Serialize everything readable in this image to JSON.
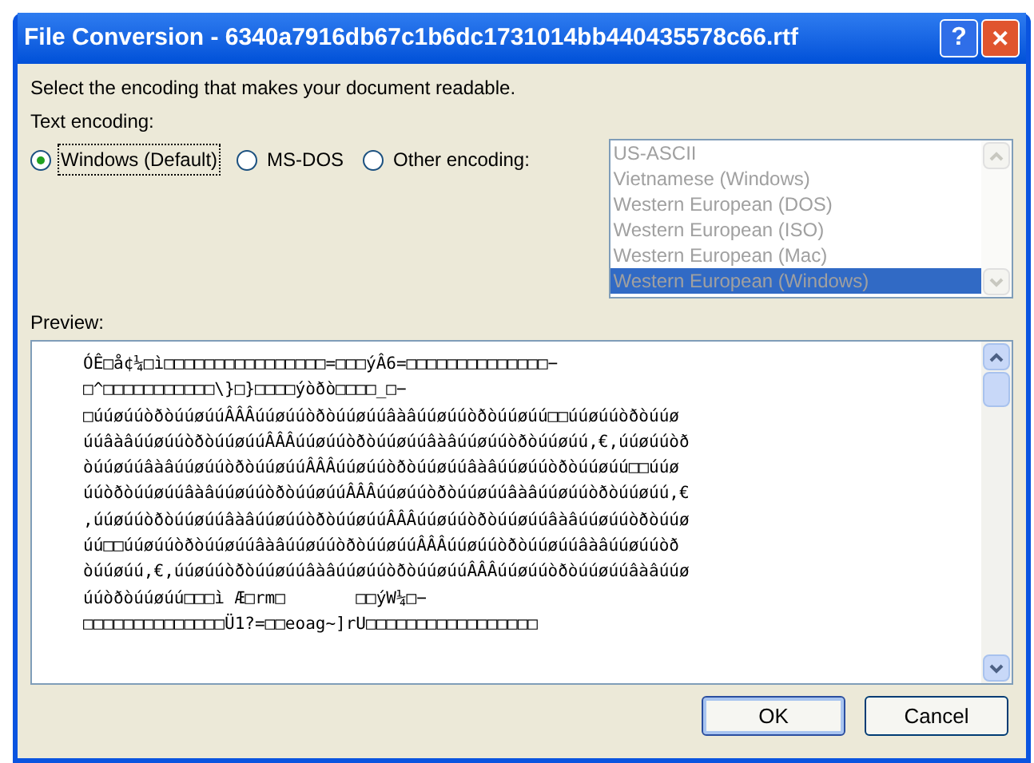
{
  "window": {
    "title": "File Conversion - 6340a7916db67c1b6dc1731014bb440435578c66.rtf",
    "help_button": "?",
    "close_button": "✕"
  },
  "instruction": "Select the encoding that makes your document readable.",
  "encoding_label": "Text encoding:",
  "encodings": [
    {
      "label": "Windows (Default)",
      "selected": true
    },
    {
      "label": "MS-DOS",
      "selected": false
    },
    {
      "label": "Other encoding:",
      "selected": false
    }
  ],
  "encoding_list": {
    "disabled": true,
    "items": [
      {
        "label": "US-ASCII",
        "selected": false
      },
      {
        "label": "Vietnamese (Windows)",
        "selected": false
      },
      {
        "label": "Western European (DOS)",
        "selected": false
      },
      {
        "label": "Western European (ISO)",
        "selected": false
      },
      {
        "label": "Western European (Mac)",
        "selected": false
      },
      {
        "label": "Western European (Windows)",
        "selected": true
      }
    ]
  },
  "preview": {
    "label": "Preview:",
    "lines": [
      "ÓÊ□å¢¼□ì□□□□□□□□□□□□□□□□=□□□ýÂ6=□□□□□□□□□□□□□□−",
      "□^□□□□□□□□□□□\\}□}□□□□ýòðò□□□□_□−",
      "□úúøúúòðòúúøúúÂÂÂúúøúúòðòúúøúúâàâúúøúúòðòúúøúú□□úúøúúòðòúúø",
      "úúâàâúúøúúòðòúúøúúÂÂÂúúøúúòðòúúøúúâàâúúøúúòðòúúøúú,€,úúøúúòð",
      "òúúøúúâàâúúøúúòðòúúøúúÂÂÂúúøúúòðòúúøúúâàâúúøúúòðòúúøúú□□úúø",
      "úúòðòúúøúúâàâúúøúúòðòúúøúúÂÂÂúúøúúòðòúúøúúâàâúúøúúòðòúúøúú,€",
      ",úúøúúòðòúúøúúâàâúúøúúòðòúúøúúÂÂÂúúøúúòðòúúøúúâàâúúøúúòðòúúø",
      "úú□□úúøúúòðòúúøúúâàâúúøúúòðòúúøúúÂÂÂúúøúúòðòúúøúúâàâúúøúúòð",
      "òúúøúú,€,úúøúúòðòúúøúúâàâúúøúúòðòúúøúúÂÂÂúúøúúòðòúúøúúâàâúúø",
      "úúòðòúúøúú□□□ì Æ□rm□       □□ýW¼□−",
      "□□□□□□□□□□□□□□Ü1?=□□eoag~]rU□□□□□□□□□□□□□□□□□"
    ]
  },
  "buttons": [
    {
      "label": "OK",
      "default": true
    },
    {
      "label": "Cancel",
      "default": false
    }
  ]
}
